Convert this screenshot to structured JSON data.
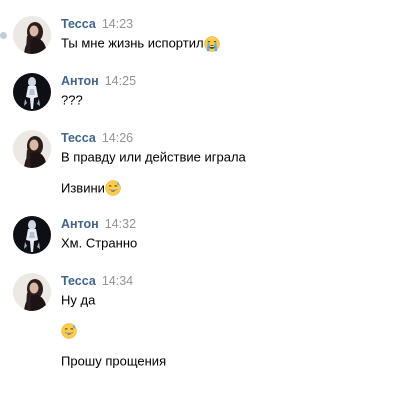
{
  "chat": {
    "messages": [
      {
        "author": "Тесса",
        "time": "14:23",
        "avatar_icon": "tessa-avatar-icon",
        "lines": [
          {
            "text": "Ты мне жизнь испортил",
            "emoji": "loudly-crying-face-icon"
          }
        ]
      },
      {
        "author": "Антон",
        "time": "14:25",
        "avatar_icon": "anton-avatar-icon",
        "lines": [
          {
            "text": "???"
          }
        ]
      },
      {
        "author": "Тесса",
        "time": "14:26",
        "avatar_icon": "tessa-avatar-icon",
        "lines": [
          {
            "text": "В правду или действие играла"
          },
          {
            "text": "Извини",
            "emoji": "grinning-face-with-sweat-icon"
          }
        ]
      },
      {
        "author": "Антон",
        "time": "14:32",
        "avatar_icon": "anton-avatar-icon",
        "lines": [
          {
            "text": "Хм. Странно"
          }
        ]
      },
      {
        "author": "Тесса",
        "time": "14:34",
        "avatar_icon": "tessa-avatar-icon",
        "lines": [
          {
            "text": "Ну да"
          },
          {
            "text": "",
            "emoji": "grinning-face-with-sweat-icon"
          },
          {
            "text": "Прошу прощения"
          }
        ]
      }
    ]
  },
  "colors": {
    "author_name": "#42648b",
    "timestamp": "#939393",
    "message_text": "#000000",
    "unread_dot": "#c3ccd6",
    "emoji_face": "#ffcc4d",
    "emoji_tear": "#5dadec"
  }
}
